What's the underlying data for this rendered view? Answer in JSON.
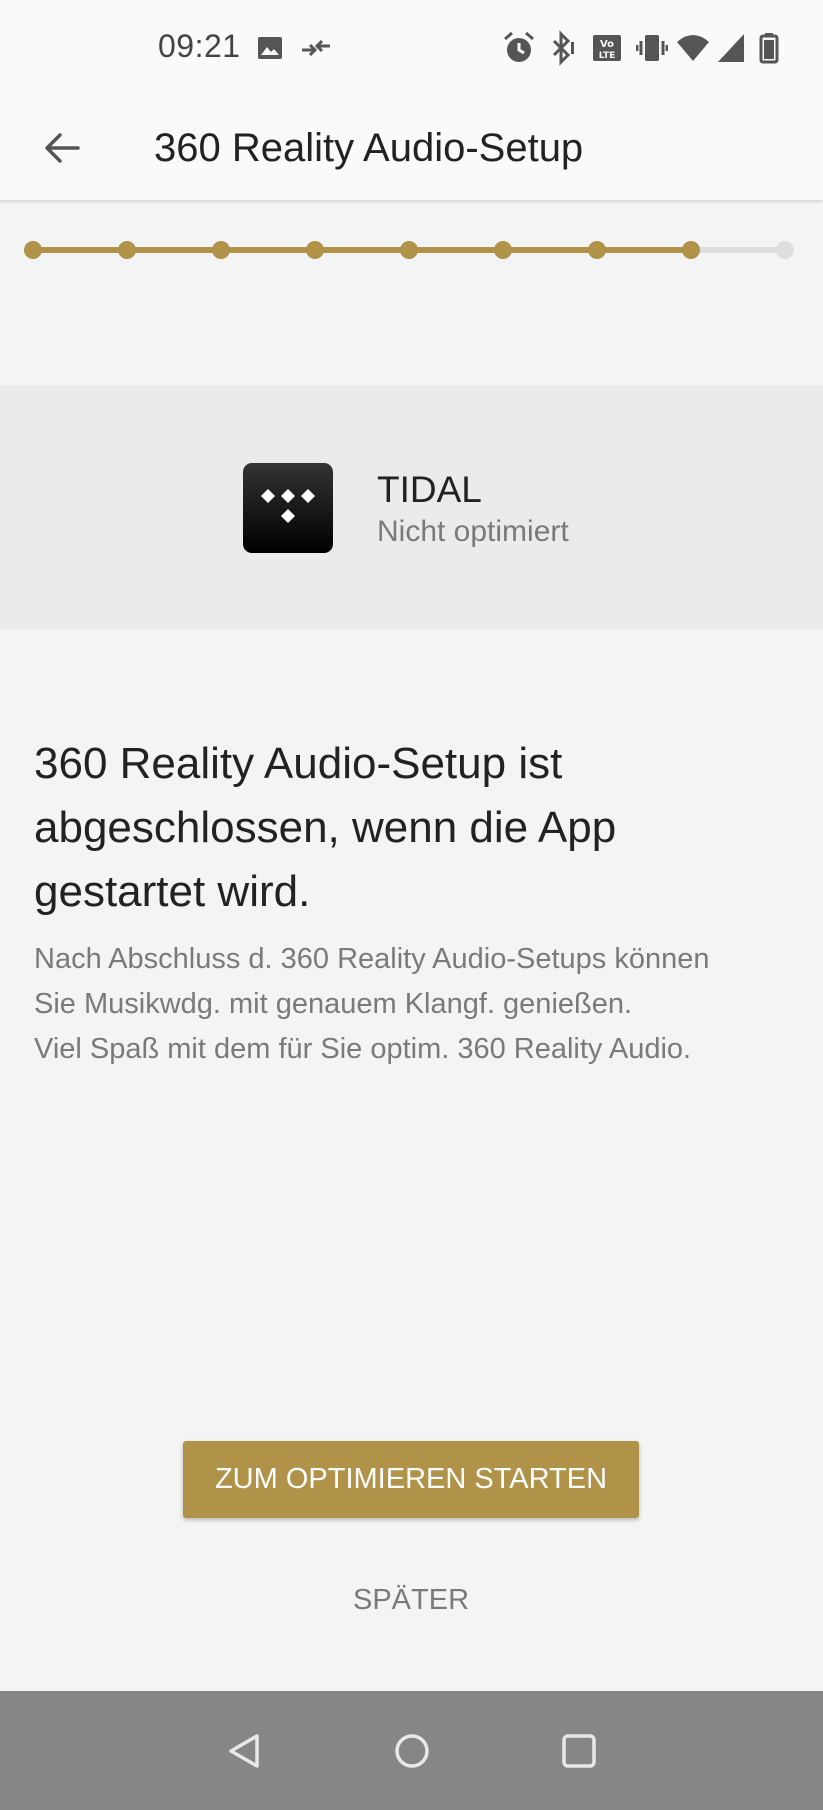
{
  "status_bar": {
    "time": "09:21",
    "icons": [
      "image-icon",
      "data-transfer-icon",
      "alarm-icon",
      "bluetooth-icon",
      "volte-icon",
      "vibrate-icon",
      "wifi-icon",
      "signal-icon",
      "battery-icon"
    ],
    "volte_label_top": "Vo",
    "volte_label_bottom": "LTE"
  },
  "app_bar": {
    "back_icon": "arrow-left-icon",
    "title": "360 Reality Audio-Setup"
  },
  "progress": {
    "total_steps": 9,
    "completed_steps": 8,
    "active_color": "#b09248",
    "inactive_color": "#dedede"
  },
  "app_card": {
    "icon": "tidal-logo-icon",
    "name": "TIDAL",
    "status": "Nicht optimiert"
  },
  "content": {
    "headline": "360 Reality Audio-Setup ist abgeschlossen, wenn die App gestartet wird.",
    "body_lines": [
      "Nach Abschluss d. 360 Reality Audio-Setups können",
      "Sie Musikwdg. mit genauem Klangf. genießen.",
      "Viel Spaß mit dem für Sie optim. 360 Reality Audio."
    ]
  },
  "actions": {
    "primary_label": "ZUM OPTIMIEREN STARTEN",
    "secondary_label": "SPÄTER",
    "accent_color": "#b09248"
  },
  "nav_bar": {
    "icons": [
      "nav-back-icon",
      "nav-home-icon",
      "nav-recents-icon"
    ]
  }
}
